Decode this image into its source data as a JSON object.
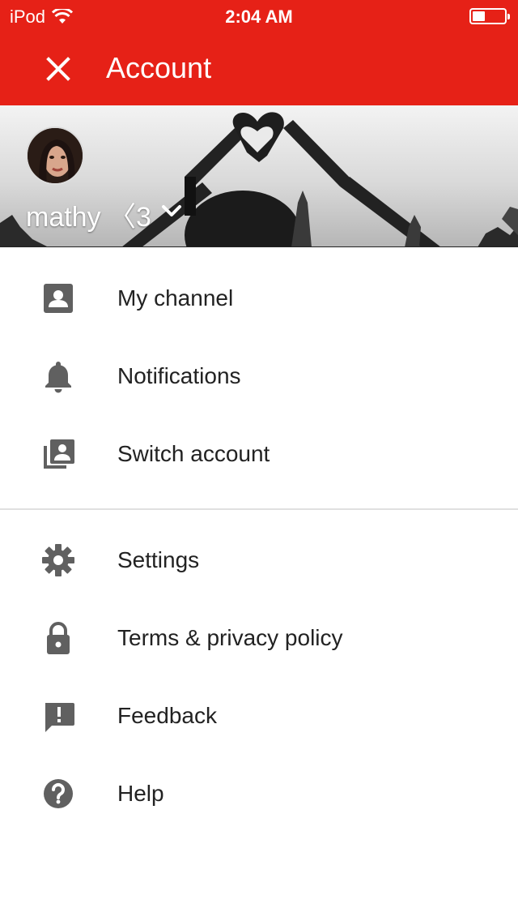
{
  "status_bar": {
    "carrier": "iPod",
    "time": "2:04 AM",
    "battery_level": 0.45
  },
  "app_bar": {
    "title": "Account",
    "close_icon": "close-icon"
  },
  "account": {
    "name": "mathy 〈3",
    "switch_icon": "chevron-down-icon"
  },
  "menu_primary": [
    {
      "label": "My channel",
      "icon": "account-box-icon"
    },
    {
      "label": "Notifications",
      "icon": "bell-icon"
    },
    {
      "label": "Switch account",
      "icon": "switch-account-icon"
    }
  ],
  "menu_secondary": [
    {
      "label": "Settings",
      "icon": "gear-icon"
    },
    {
      "label": "Terms & privacy policy",
      "icon": "lock-icon"
    },
    {
      "label": "Feedback",
      "icon": "feedback-icon"
    },
    {
      "label": "Help",
      "icon": "help-icon"
    }
  ],
  "colors": {
    "brand_red": "#e62117",
    "icon_gray": "#606060",
    "text": "#222222"
  }
}
